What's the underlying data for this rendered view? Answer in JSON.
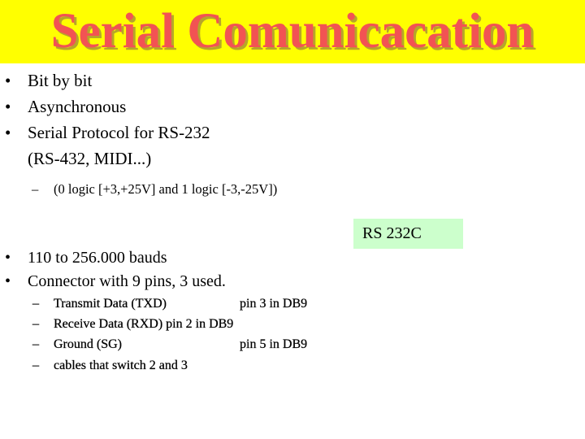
{
  "slide": {
    "title": "Serial Comunicacation",
    "colors": {
      "header_bg": "#ffff00",
      "title_text": "#f25353",
      "title_shadow": "#b7a52a",
      "tag_bg": "#ccffcc"
    },
    "bullet_glyph": "•",
    "dash_glyph": "–",
    "bullets_top": [
      {
        "text": "Bit by bit"
      },
      {
        "text": "Asynchronous"
      },
      {
        "text": "Serial Protocol for  RS-232"
      },
      {
        "text": "(RS-432, MIDI...)"
      }
    ],
    "sub_top": {
      "text": "(0 logic [+3,+25V] and 1 logic [-3,-25V])"
    },
    "tag": {
      "text": "RS 232C"
    },
    "bullets_bottom": [
      {
        "text": "110 to 256.000 bauds"
      },
      {
        "text": "Connector with 9 pins, 3 used."
      }
    ],
    "sub_bottom": [
      {
        "label": "Transmit Data (TXD)",
        "pin": "pin 3 in DB9"
      },
      {
        "label": "Receive Data (RXD)",
        "pin": "pin 2 in DB9"
      },
      {
        "label": "Ground (SG)",
        "pin": "pin 5 in DB9"
      },
      {
        "label": "cables that switch 2 and 3",
        "pin": ""
      }
    ]
  }
}
